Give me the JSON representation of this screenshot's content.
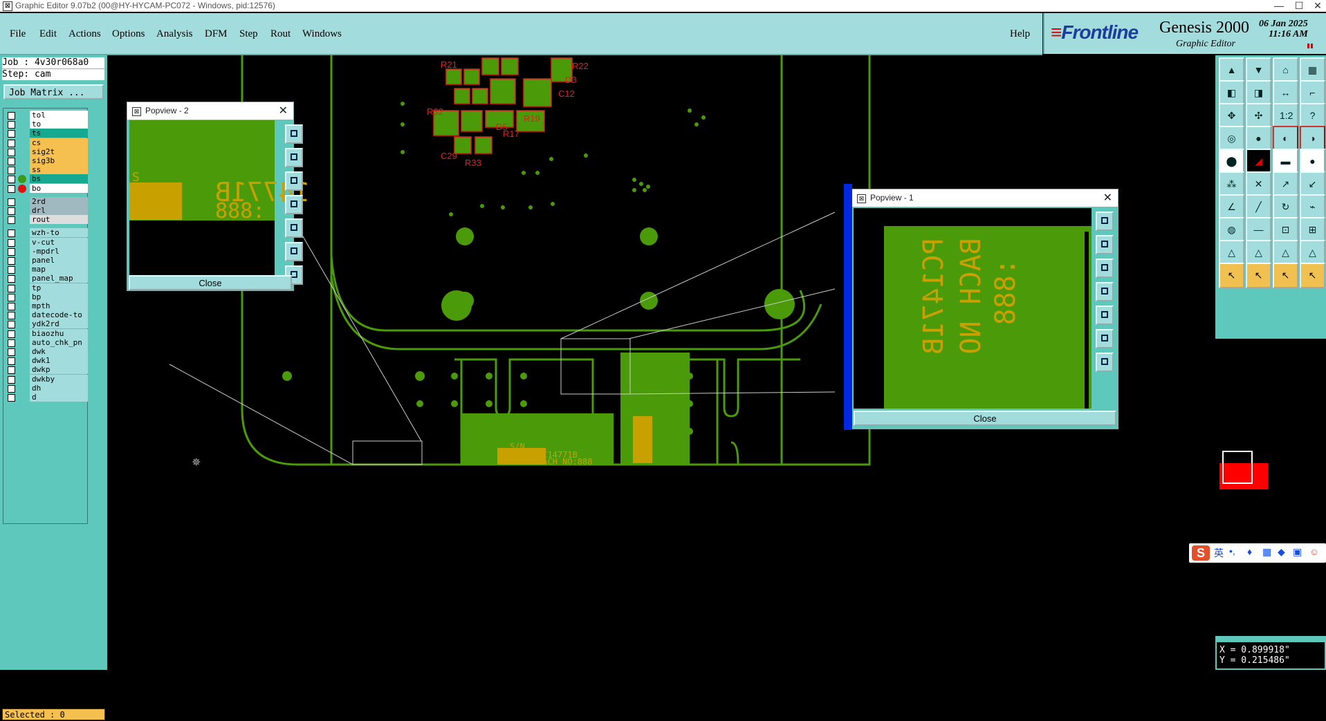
{
  "window": {
    "title": "Graphic Editor 9.07b2 (00@HY-HYCAM-PC072 - Windows, pid:12576)",
    "minimize": "—",
    "maximize": "☐",
    "close": "✕"
  },
  "menu": [
    "File",
    "Edit",
    "Actions",
    "Options",
    "Analysis",
    "DFM",
    "Step",
    "Rout",
    "Windows"
  ],
  "help": "Help",
  "brand": {
    "logo": "Frontline",
    "product": "Genesis 2000",
    "subtitle": "Graphic Editor",
    "date": "06 Jan 2025",
    "time": "11:16 AM"
  },
  "job": {
    "job": "Job : 4v30r068a0",
    "step": "Step: cam",
    "matrix_button": "Job Matrix ..."
  },
  "layers": [
    {
      "name": "tol",
      "color": "#ffffff",
      "dot": ""
    },
    {
      "name": "to",
      "color": "#ffffff",
      "dot": ""
    },
    {
      "name": "ts",
      "color": "#17a890",
      "dot": ""
    },
    {
      "name": "cs",
      "color": "#f5c050",
      "dot": ""
    },
    {
      "name": "sig2t",
      "color": "#f5c050",
      "dot": ""
    },
    {
      "name": "sig3b",
      "color": "#f5c050",
      "dot": ""
    },
    {
      "name": "ss",
      "color": "#f5c050",
      "dot": ""
    },
    {
      "name": "bs",
      "color": "#17a890",
      "dot": "#3a9a1a"
    },
    {
      "name": "bo",
      "color": "#ffffff",
      "dot": "#e01010"
    },
    {
      "name": "2rd",
      "color": "#a0b8c0",
      "dot": ""
    },
    {
      "name": "drl",
      "color": "#a0b8c0",
      "dot": ""
    },
    {
      "name": "rout",
      "color": "#dddddd",
      "dot": ""
    },
    {
      "name": "wzh-to",
      "color": "#a3dcdc",
      "dot": ""
    },
    {
      "name": "v-cut",
      "color": "#a3dcdc",
      "dot": ""
    },
    {
      "name": "-mpdrl",
      "color": "#a3dcdc",
      "dot": ""
    },
    {
      "name": "panel",
      "color": "#a3dcdc",
      "dot": ""
    },
    {
      "name": "map",
      "color": "#a3dcdc",
      "dot": ""
    },
    {
      "name": "panel_map",
      "color": "#a3dcdc",
      "dot": ""
    },
    {
      "name": "tp",
      "color": "#a3dcdc",
      "dot": ""
    },
    {
      "name": "bp",
      "color": "#a3dcdc",
      "dot": ""
    },
    {
      "name": "mpth",
      "color": "#a3dcdc",
      "dot": ""
    },
    {
      "name": "datecode-to",
      "color": "#a3dcdc",
      "dot": ""
    },
    {
      "name": "ydk2rd",
      "color": "#a3dcdc",
      "dot": ""
    },
    {
      "name": "biaozhu",
      "color": "#a3dcdc",
      "dot": ""
    },
    {
      "name": "auto_chk_pn",
      "color": "#a3dcdc",
      "dot": ""
    },
    {
      "name": "dwk",
      "color": "#a3dcdc",
      "dot": ""
    },
    {
      "name": "dwk1",
      "color": "#a3dcdc",
      "dot": ""
    },
    {
      "name": "dwkp",
      "color": "#a3dcdc",
      "dot": ""
    },
    {
      "name": "dwkby",
      "color": "#a3dcdc",
      "dot": ""
    },
    {
      "name": "dh",
      "color": "#a3dcdc",
      "dot": ""
    },
    {
      "name": "d",
      "color": "#a3dcdc",
      "dot": ""
    }
  ],
  "selected": "Selected : 0",
  "popview2": {
    "title": "Popview - 2",
    "close": "Close",
    "text1": "14771B",
    "text2": ":888",
    "text3": "S"
  },
  "popview1": {
    "title": "Popview - 1",
    "close": "Close",
    "line1": "PC1471B",
    "line2": "BACH NO",
    "line3": ":888"
  },
  "pcb_labels": [
    "R21",
    "R32",
    "C12",
    "R19",
    "R33",
    "C29",
    "R17",
    "D5",
    "R22",
    "D3"
  ],
  "board_text": {
    "a": "PC14771B",
    "b": "BACH NO:888",
    "c": "S/N",
    "d": "PC1477B",
    "e": "BACH NO",
    "f": ":888"
  },
  "coords": {
    "x": "X = 0.899918\"",
    "y": "Y = 0.215486\""
  },
  "ime": {
    "lang": "英",
    "marks": "•,"
  },
  "colors": {
    "accent": "#a3dcdc",
    "panel": "#5fc8bc",
    "copper": "#4a9a0a",
    "silk": "#c8a000",
    "outline": "#e02020"
  }
}
